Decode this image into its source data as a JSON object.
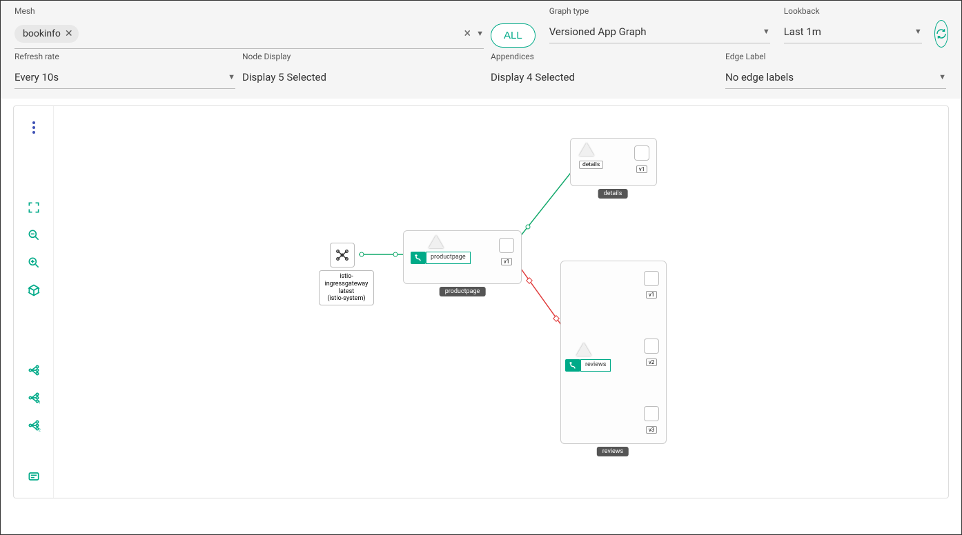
{
  "filters": {
    "mesh_label": "Mesh",
    "mesh_chip": "bookinfo",
    "all_button": "ALL",
    "graph_type_label": "Graph type",
    "graph_type_value": "Versioned App Graph",
    "lookback_label": "Lookback",
    "lookback_value": "Last 1m",
    "refresh_rate_label": "Refresh rate",
    "refresh_rate_value": "Every 10s",
    "node_display_label": "Node Display",
    "node_display_value": "Display 5 Selected",
    "appendices_label": "Appendices",
    "appendices_value": "Display 4 Selected",
    "edge_label_label": "Edge Label",
    "edge_label_value": "No edge labels"
  },
  "graph": {
    "colors": {
      "ok": "#11a86b",
      "error": "#e03b3b",
      "neutral": "#888"
    },
    "nodes": {
      "ingress": {
        "line1": "istio-ingressgateway",
        "line2": "latest",
        "line3": "(istio-system)"
      },
      "productpage": {
        "service": "productpage",
        "versions": [
          "v1"
        ],
        "group_tag": "productpage",
        "has_virtualservice": true
      },
      "details": {
        "service": "details",
        "versions": [
          "v1"
        ],
        "group_tag": "details",
        "has_virtualservice": false
      },
      "reviews": {
        "service": "reviews",
        "versions": [
          "v1",
          "v2",
          "v3"
        ],
        "group_tag": "reviews",
        "has_virtualservice": true
      }
    },
    "edges": [
      {
        "from": "ingress",
        "to": "productpage.service",
        "status": "ok"
      },
      {
        "from": "productpage.service",
        "to": "productpage.v1",
        "status": "ok"
      },
      {
        "from": "productpage.v1",
        "to": "details.service",
        "status": "ok"
      },
      {
        "from": "details.service",
        "to": "details.v1",
        "status": "ok"
      },
      {
        "from": "productpage.v1",
        "to": "reviews.service",
        "status": "error"
      },
      {
        "from": "reviews.service",
        "to": "reviews.v1",
        "status": "error"
      },
      {
        "from": "reviews.service",
        "to": "reviews.v2",
        "status": "error"
      },
      {
        "from": "reviews.service",
        "to": "reviews.v3",
        "status": "error"
      }
    ]
  }
}
